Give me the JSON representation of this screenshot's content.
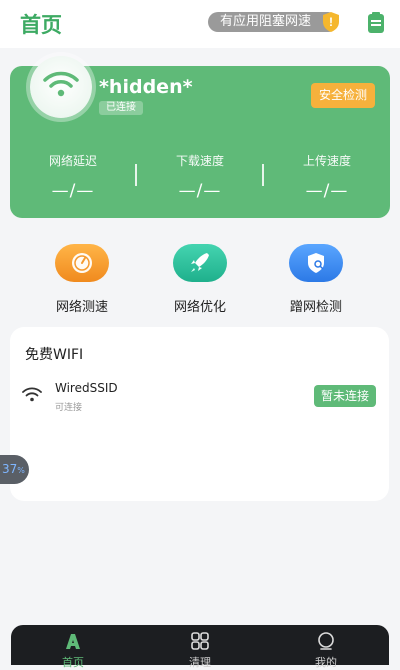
{
  "header": {
    "title": "首页",
    "warning_text": "有应用阻塞网速",
    "warning_mark": "!"
  },
  "connection_card": {
    "ssid": "*hidden*",
    "status_badge": "已连接",
    "safety_button": "安全检测",
    "stats": [
      {
        "label": "网络延迟",
        "value": "—/—"
      },
      {
        "label": "下载速度",
        "value": "—/—"
      },
      {
        "label": "上传速度",
        "value": "—/—"
      }
    ]
  },
  "tools": [
    {
      "label": "网络测速",
      "icon": "speedometer-icon",
      "color": "#f59a2e"
    },
    {
      "label": "网络优化",
      "icon": "rocket-icon",
      "color": "#2fc3a0"
    },
    {
      "label": "蹭网检测",
      "icon": "shield-search-icon",
      "color": "#3a8ef0"
    }
  ],
  "free_wifi": {
    "title": "免费WIFI",
    "networks": [
      {
        "ssid": "WiredSSID",
        "status": "可连接",
        "button": "暂未连接"
      }
    ]
  },
  "float_ball": {
    "value": "37",
    "unit": "%"
  },
  "tabbar": {
    "items": [
      {
        "label": "首页",
        "icon": "home-icon",
        "active": true
      },
      {
        "label": "清理",
        "icon": "grid-icon",
        "active": false
      },
      {
        "label": "我的",
        "icon": "profile-icon",
        "active": false
      }
    ]
  },
  "colors": {
    "brand_green": "#5fba78",
    "title_green": "#3daa63",
    "orange": "#f6b13c",
    "tabbar_bg": "#1c1e21"
  }
}
